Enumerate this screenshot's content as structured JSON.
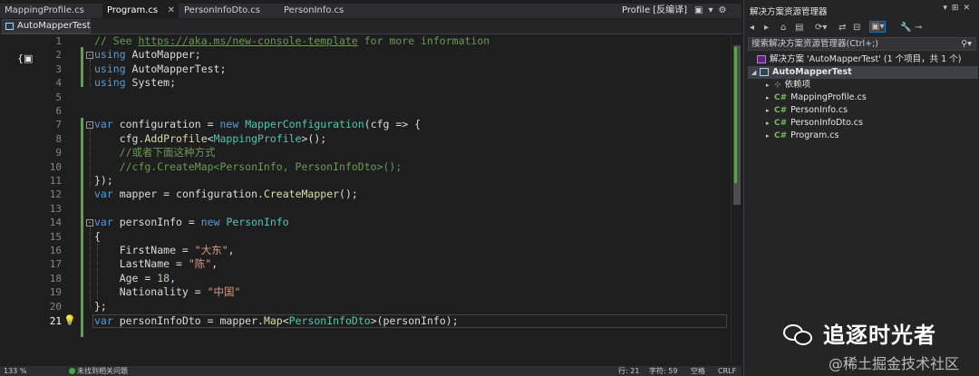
{
  "tabs": [
    {
      "label": "MappingProfile.cs",
      "close": ""
    },
    {
      "label": "Program.cs",
      "close": "✕"
    },
    {
      "label": "PersonInfoDto.cs",
      "close": ""
    },
    {
      "label": "PersonInfo.cs",
      "close": ""
    }
  ],
  "profile_label": "Profile [反编译]",
  "navbar": {
    "project": "AutoMapperTest"
  },
  "code": {
    "line_numbers": [
      "1",
      "2",
      "3",
      "4",
      "5",
      "6",
      "7",
      "8",
      "9",
      "10",
      "11",
      "12",
      "13",
      "14",
      "15",
      "16",
      "17",
      "18",
      "19",
      "20",
      "21"
    ],
    "current_line": "21",
    "l1_comment": "// See ",
    "l1_link": "https://aka.ms/new-console-template",
    "l1_tail": " for more information",
    "using": "using",
    "l2_ns": " AutoMapper;",
    "l3_ns": " AutoMapperTest;",
    "l4_ns": " System;",
    "var": "var",
    "new": "new",
    "l7_a": " configuration = ",
    "l7_type": "MapperConfiguration",
    "l7_b": "(cfg => {",
    "l8_a": "    cfg.",
    "l8_fn": "AddProfile",
    "l8_lt": "<",
    "l8_type": "MappingProfile",
    "l8_b": ">();",
    "l9_comment": "    //或者下面这种方式",
    "l10_comment": "    //cfg.CreateMap<PersonInfo, PersonInfoDto>();",
    "l11": "});",
    "l12_a": " mapper = configuration.",
    "l12_fn": "CreateMapper",
    "l12_b": "();",
    "l14_a": " personInfo = ",
    "l14_type": "PersonInfo",
    "l15": "{",
    "l16_a": "    FirstName = ",
    "l16_str": "\"大东\"",
    "l16_b": ",",
    "l17_a": "    LastName = ",
    "l17_str": "\"陈\"",
    "l17_b": ",",
    "l18_a": "    Age = ",
    "l18_num": "18",
    "l18_b": ",",
    "l19_a": "    Nationality = ",
    "l19_str": "\"中国\"",
    "l20": "};",
    "l21_a": " personInfoDto = mapper.",
    "l21_fn": "Map",
    "l21_lt": "<",
    "l21_type": "PersonInfoDto",
    "l21_b": ">(personInfo);"
  },
  "statusbar": {
    "zoom": "133 %",
    "issues": "未找到相关问题",
    "line": "行: 21",
    "char": "字符: 59",
    "mode": "空格",
    "eol": "CRLF"
  },
  "solution_explorer": {
    "title": "解决方案资源管理器",
    "search_placeholder": "搜索解决方案资源管理器(Ctrl+;)",
    "solution": "解决方案 'AutoMapperTest' (1 个项目，共 1 个)",
    "project": "AutoMapperTest",
    "items": [
      {
        "label": "依赖项",
        "icon": "dependencies-icon"
      },
      {
        "label": "MappingProfile.cs",
        "icon": "csharp-file-icon"
      },
      {
        "label": "PersonInfo.cs",
        "icon": "csharp-file-icon"
      },
      {
        "label": "PersonInfoDto.cs",
        "icon": "csharp-file-icon"
      },
      {
        "label": "Program.cs",
        "icon": "csharp-file-icon"
      }
    ]
  },
  "watermark": {
    "name": "追逐时光者",
    "site": "@稀土掘金技术社区"
  },
  "colors": {
    "editor_bg": "#1e1e1e",
    "keyword": "#569cd6",
    "type": "#4ec9b0",
    "comment": "#6a9955",
    "string": "#d69d85",
    "method": "#dcdcaa",
    "change_bar": "#57a64a"
  }
}
